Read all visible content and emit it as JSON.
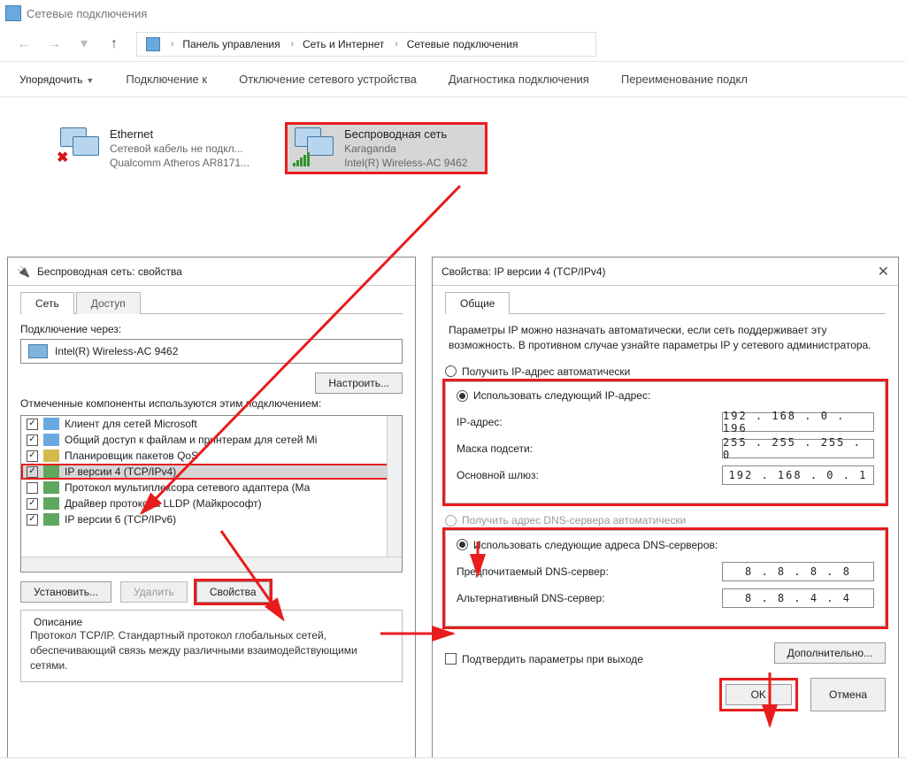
{
  "window_title": "Сетевые подключения",
  "breadcrumb": {
    "root": "Панель управления",
    "net": "Сеть и Интернет",
    "conn": "Сетевые подключения"
  },
  "toolbar": {
    "organize": "Упорядочить",
    "connect": "Подключение к",
    "disable": "Отключение сетевого устройства",
    "diag": "Диагностика подключения",
    "rename": "Переименование подкл"
  },
  "eth": {
    "name": "Ethernet",
    "status": "Сетевой кабель не подкл...",
    "adapter": "Qualcomm Atheros AR8171..."
  },
  "wifi": {
    "name": "Беспроводная сеть",
    "ssid": "Karaganda",
    "adapter": "Intel(R) Wireless-AC 9462"
  },
  "props": {
    "title": "Беспроводная сеть: свойства",
    "tab_net": "Сеть",
    "tab_access": "Доступ",
    "via_label": "Подключение через:",
    "adapter": "Intel(R) Wireless-AC 9462",
    "configure": "Настроить...",
    "comp_label": "Отмеченные компоненты используются этим подключением:",
    "items": [
      "Клиент для сетей Microsoft",
      "Общий доступ к файлам и принтерам для сетей Mi",
      "Планировщик пакетов QoS",
      "IP версии 4 (TCP/IPv4)",
      "Протокол мультиплексора сетевого адаптера (Ма",
      "Драйвер протокола LLDP (Майкрософт)",
      "IP версии 6 (TCP/IPv6)"
    ],
    "install": "Установить...",
    "remove": "Удалить",
    "props_btn": "Свойства",
    "desc_h": "Описание",
    "desc": "Протокол TCP/IP. Стандартный протокол глобальных сетей, обеспечивающий связь между различными взаимодействующими сетями."
  },
  "ipv4": {
    "title": "Свойства: IP версии 4 (TCP/IPv4)",
    "tab": "Общие",
    "info": "Параметры IP можно назначать автоматически, если сеть поддерживает эту возможность. В противном случае узнайте параметры IP у сетевого администратора.",
    "auto_ip": "Получить IP-адрес автоматически",
    "use_ip": "Использовать следующий IP-адрес:",
    "lbl_ip": "IP-адрес:",
    "lbl_mask": "Маска подсети:",
    "lbl_gw": "Основной шлюз:",
    "val_ip": "192 . 168 .  0  . 196",
    "val_mask": "255 . 255 . 255 .  0",
    "val_gw": "192 . 168 .  0  .  1",
    "auto_dns": "Получить адрес DNS-сервера автоматически",
    "use_dns": "Использовать следующие адреса DNS-серверов:",
    "lbl_dns1": "Предпочитаемый DNS-сервер:",
    "lbl_dns2": "Альтернативный DNS-сервер:",
    "val_dns1": "8  .  8  .  8  .  8",
    "val_dns2": "8  .  8  .  4  .  4",
    "confirm": "Подтвердить параметры при выходе",
    "adv": "Дополнительно...",
    "ok": "OK",
    "cancel": "Отмена"
  }
}
